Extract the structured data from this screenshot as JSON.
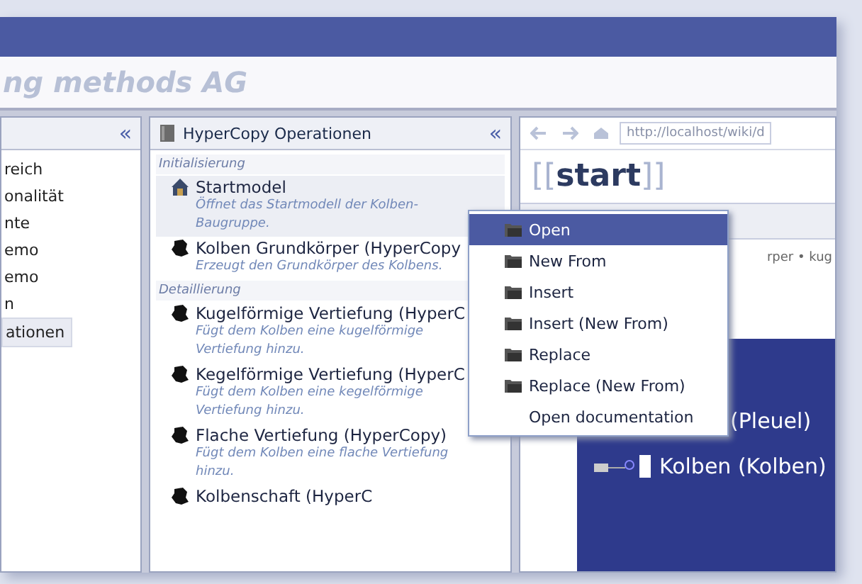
{
  "header": {
    "title": "ng methods AG"
  },
  "left_panel": {
    "collapse": "«",
    "items": [
      {
        "label": "reich",
        "selected": false
      },
      {
        "label": "onalität",
        "selected": false
      },
      {
        "label": "nte",
        "selected": false
      },
      {
        "label": "emo",
        "selected": false
      },
      {
        "label": "emo",
        "selected": false
      },
      {
        "label": "n",
        "selected": false
      },
      {
        "label": "ationen",
        "selected": true
      }
    ]
  },
  "operations_panel": {
    "title": "HyperCopy Operationen",
    "collapse": "«",
    "sections": [
      {
        "heading": "Initialisierung",
        "items": [
          {
            "kind": "model",
            "title": "Startmodel",
            "description": "Öffnet das Startmodell der Kolben-Baugruppe.",
            "selected": true
          },
          {
            "kind": "operation",
            "title": "Kolben Grundkörper (HyperCopy",
            "description": "Erzeugt den Grundkörper des Kolbens.",
            "selected": false
          }
        ]
      },
      {
        "heading": "Detaillierung",
        "items": [
          {
            "kind": "operation",
            "title": "Kugelförmige Vertiefung (HyperC",
            "description": "Fügt dem Kolben eine kugelförmige Vertiefung hinzu.",
            "selected": false
          },
          {
            "kind": "operation",
            "title": "Kegelförmige Vertiefung (HyperC",
            "description": "Fügt dem Kolben eine kegelförmige Vertiefung hinzu.",
            "selected": false
          },
          {
            "kind": "operation",
            "title": "Flache Vertiefung (HyperCopy)",
            "description": "Fügt dem Kolben eine flache Vertiefung hinzu.",
            "selected": false
          },
          {
            "kind": "operation",
            "title": "Kolbenschaft (HyperC",
            "selected": false
          }
        ]
      }
    ]
  },
  "browser": {
    "url": "http://localhost/wiki/d",
    "page_title": {
      "open": "[[",
      "text": "start",
      "close": "]]"
    },
    "breadcrumb": "rper • kug",
    "tree": [
      {
        "label": "(Pleuel)"
      },
      {
        "label": "Kolben (Kolben)"
      }
    ]
  },
  "context_menu": {
    "items": [
      {
        "label": "Open",
        "icon": true,
        "selected": true
      },
      {
        "label": "New From",
        "icon": true,
        "selected": false
      },
      {
        "label": "Insert",
        "icon": true,
        "selected": false
      },
      {
        "label": "Insert (New From)",
        "icon": true,
        "selected": false
      },
      {
        "label": "Replace",
        "icon": true,
        "selected": false
      },
      {
        "label": "Replace (New From)",
        "icon": true,
        "selected": false
      },
      {
        "label": "Open documentation",
        "icon": false,
        "selected": false
      }
    ]
  }
}
